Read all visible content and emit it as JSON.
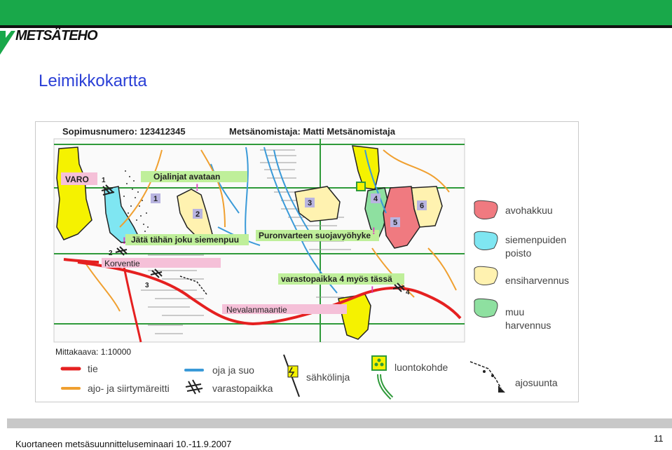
{
  "brand": {
    "name": "METSÄTEHO",
    "color": "#19a84a"
  },
  "slide": {
    "title": "Leimikkokartta",
    "footer": "Kuortaneen metsäsuunnitteluseminaari 10.-11.9.2007",
    "page_number": "11"
  },
  "map": {
    "contract_label": "Sopimusnumero: 123412345",
    "owner_label": "Metsänomistaja: Matti Metsänomistaja",
    "scale": "Mittakaava: 1:10000",
    "annotations": {
      "varo": "VARO",
      "ditches": "Ojalinjat avataan",
      "seed_tree": "Jätä tähän joku siemenpuu",
      "stream_zone": "Puronvarteen suojavyöhyke",
      "korventie": "Korventie",
      "storage": "varastopaikka 4 myös tässä",
      "nevalanmaantie": "Nevalanmaantie"
    },
    "numbers": [
      "1",
      "2",
      "3",
      "4",
      "5",
      "6"
    ],
    "markers": {
      "one": "1",
      "two": "2",
      "three": "3",
      "four": "4"
    },
    "exclamation": "!",
    "stand_legend": [
      {
        "label_lines": [
          "avohakkuu"
        ],
        "color": "#f07a80"
      },
      {
        "label_lines": [
          "siemenpuiden",
          "poisto"
        ],
        "color": "#7fe6f2"
      },
      {
        "label_lines": [
          "ensiharvennus"
        ],
        "color": "#fff2b0"
      },
      {
        "label_lines": [
          "muu",
          "harvennus"
        ],
        "color": "#8ee0a0"
      }
    ],
    "line_legend": {
      "road": "tie",
      "transit": "ajo- ja siirtymäreitti",
      "ditch": "oja ja suo",
      "storage": "varastopaikka",
      "power": "sähkölinja",
      "nature": "luontokohde",
      "drive_direction": "ajosuunta"
    },
    "colors": {
      "clearcut": "#f07a80",
      "seed_removal": "#7fe6f2",
      "first_thinning": "#fff2b0",
      "other_thinning": "#8ee0a0",
      "yellow_area": "#f5f200",
      "road": "#e52020",
      "transit": "#f0a030",
      "ditch": "#3a9ad8",
      "grid": "#2f9a3a",
      "label_green": "#bfef9a",
      "label_pink": "#f5c0d8",
      "stand_number_bg": "#b8b4e0",
      "exclamation": "#e040c0"
    }
  }
}
